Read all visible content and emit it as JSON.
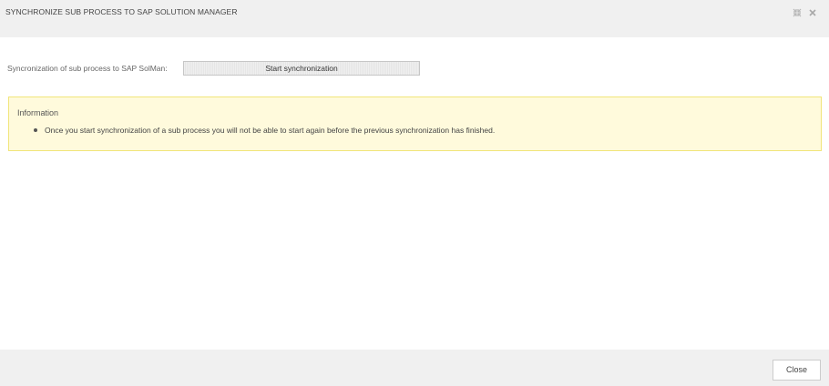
{
  "dialog": {
    "title": "SYNCHRONIZE SUB PROCESS TO SAP SOLUTION MANAGER",
    "icons": [
      "expand-icon",
      "close-icon"
    ]
  },
  "sync": {
    "label": "Syncronization of sub process to SAP SolMan:",
    "button_label": "Start synchronization"
  },
  "info": {
    "title": "Information",
    "items": [
      "Once you start synchronization of a sub process you will not be able to start again before the previous synchronization has finished."
    ]
  },
  "footer": {
    "close_label": "Close"
  },
  "colors": {
    "header_bg": "#f0f0f0",
    "info_bg": "#fffadc",
    "info_border": "#f1e57a"
  }
}
